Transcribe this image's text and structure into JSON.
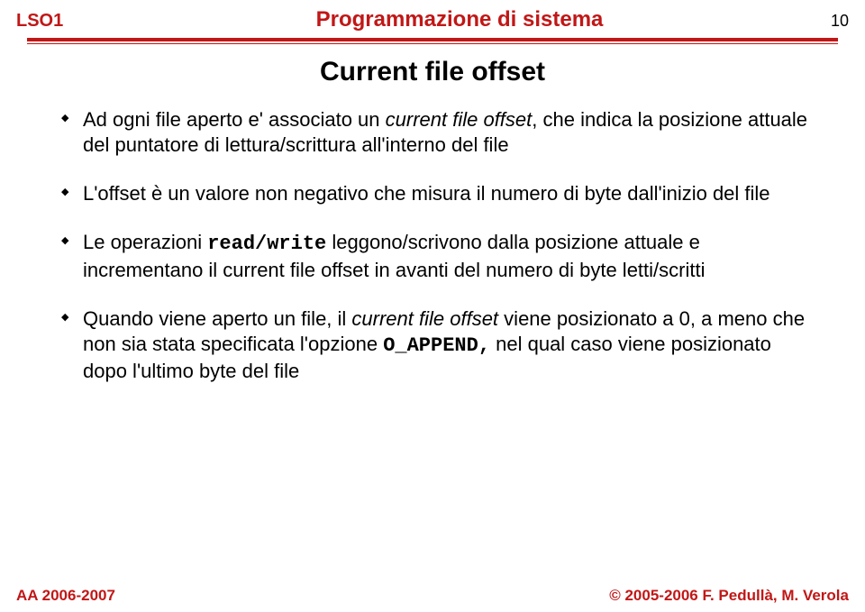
{
  "header": {
    "left": "LSO1",
    "center": "Programmazione di sistema",
    "pageNumber": "10"
  },
  "title": "Current file offset",
  "bullets": {
    "b1_pre": "Ad ogni file aperto e' associato un ",
    "b1_em": "current file offset",
    "b1_post": ", che indica la posizione attuale del puntatore di lettura/scrittura all'interno del file",
    "b2": "L'offset è un valore non negativo che misura il numero di byte dall'inizio del file",
    "b3_pre": "Le operazioni ",
    "b3_code1": "read",
    "b3_sep": "/",
    "b3_code2": "write",
    "b3_post": " leggono/scrivono dalla posizione attuale e incrementano il current file offset in avanti del numero di byte letti/scritti",
    "b4_pre": "Quando viene aperto un file, il ",
    "b4_em": "current file offset",
    "b4_mid": " viene posizionato a 0, a meno che non sia stata specificata l'opzione ",
    "b4_code": "O_APPEND",
    "b4_code_post": ",",
    "b4_post": " nel qual caso viene posizionato dopo l'ultimo byte del file"
  },
  "footer": {
    "left": "AA 2006-2007",
    "right": "© 2005-2006 F. Pedullà, M. Verola"
  }
}
